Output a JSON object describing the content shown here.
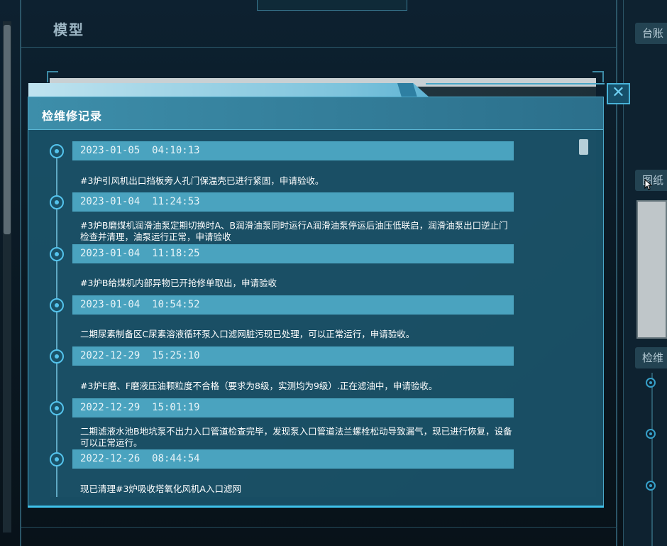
{
  "background": {
    "title": "模型",
    "right_buttons": [
      "台账",
      "图纸",
      "检维"
    ]
  },
  "modal": {
    "title": "检维修记录",
    "close_label": "✕",
    "records": [
      {
        "date": "2023-01-05  04:10:13",
        "text": "#3炉引风机出口挡板旁人孔门保温壳已进行紧固，申请验收。"
      },
      {
        "date": "2023-01-04  11:24:53",
        "text": "#3炉B磨煤机润滑油泵定期切换时A、B润滑油泵同时运行A润滑油泵停运后油压低联启，润滑油泵出口逆止门检查并清理，油泵运行正常，申请验收"
      },
      {
        "date": "2023-01-04  11:18:25",
        "text": "#3炉B给煤机内部异物已开抢修单取出，申请验收"
      },
      {
        "date": "2023-01-04  10:54:52",
        "text": "二期尿素制备区C尿素溶液循环泵入口滤网脏污现已处理，可以正常运行，申请验收。"
      },
      {
        "date": "2022-12-29  15:25:10",
        "text": "#3炉E磨、F磨液压油颗粒度不合格（要求为8级，实测均为9级）.正在滤油中，申请验收。"
      },
      {
        "date": "2022-12-29  15:01:19",
        "text": "二期滤液水池B地坑泵不出力入口管道检查完毕，发现泵入口管道法兰螺栓松动导致漏气，现已进行恢复，设备可以正常运行。"
      },
      {
        "date": "2022-12-26  08:44:54",
        "text": "现已清理#3炉吸收塔氧化风机A入口滤网"
      }
    ]
  }
}
